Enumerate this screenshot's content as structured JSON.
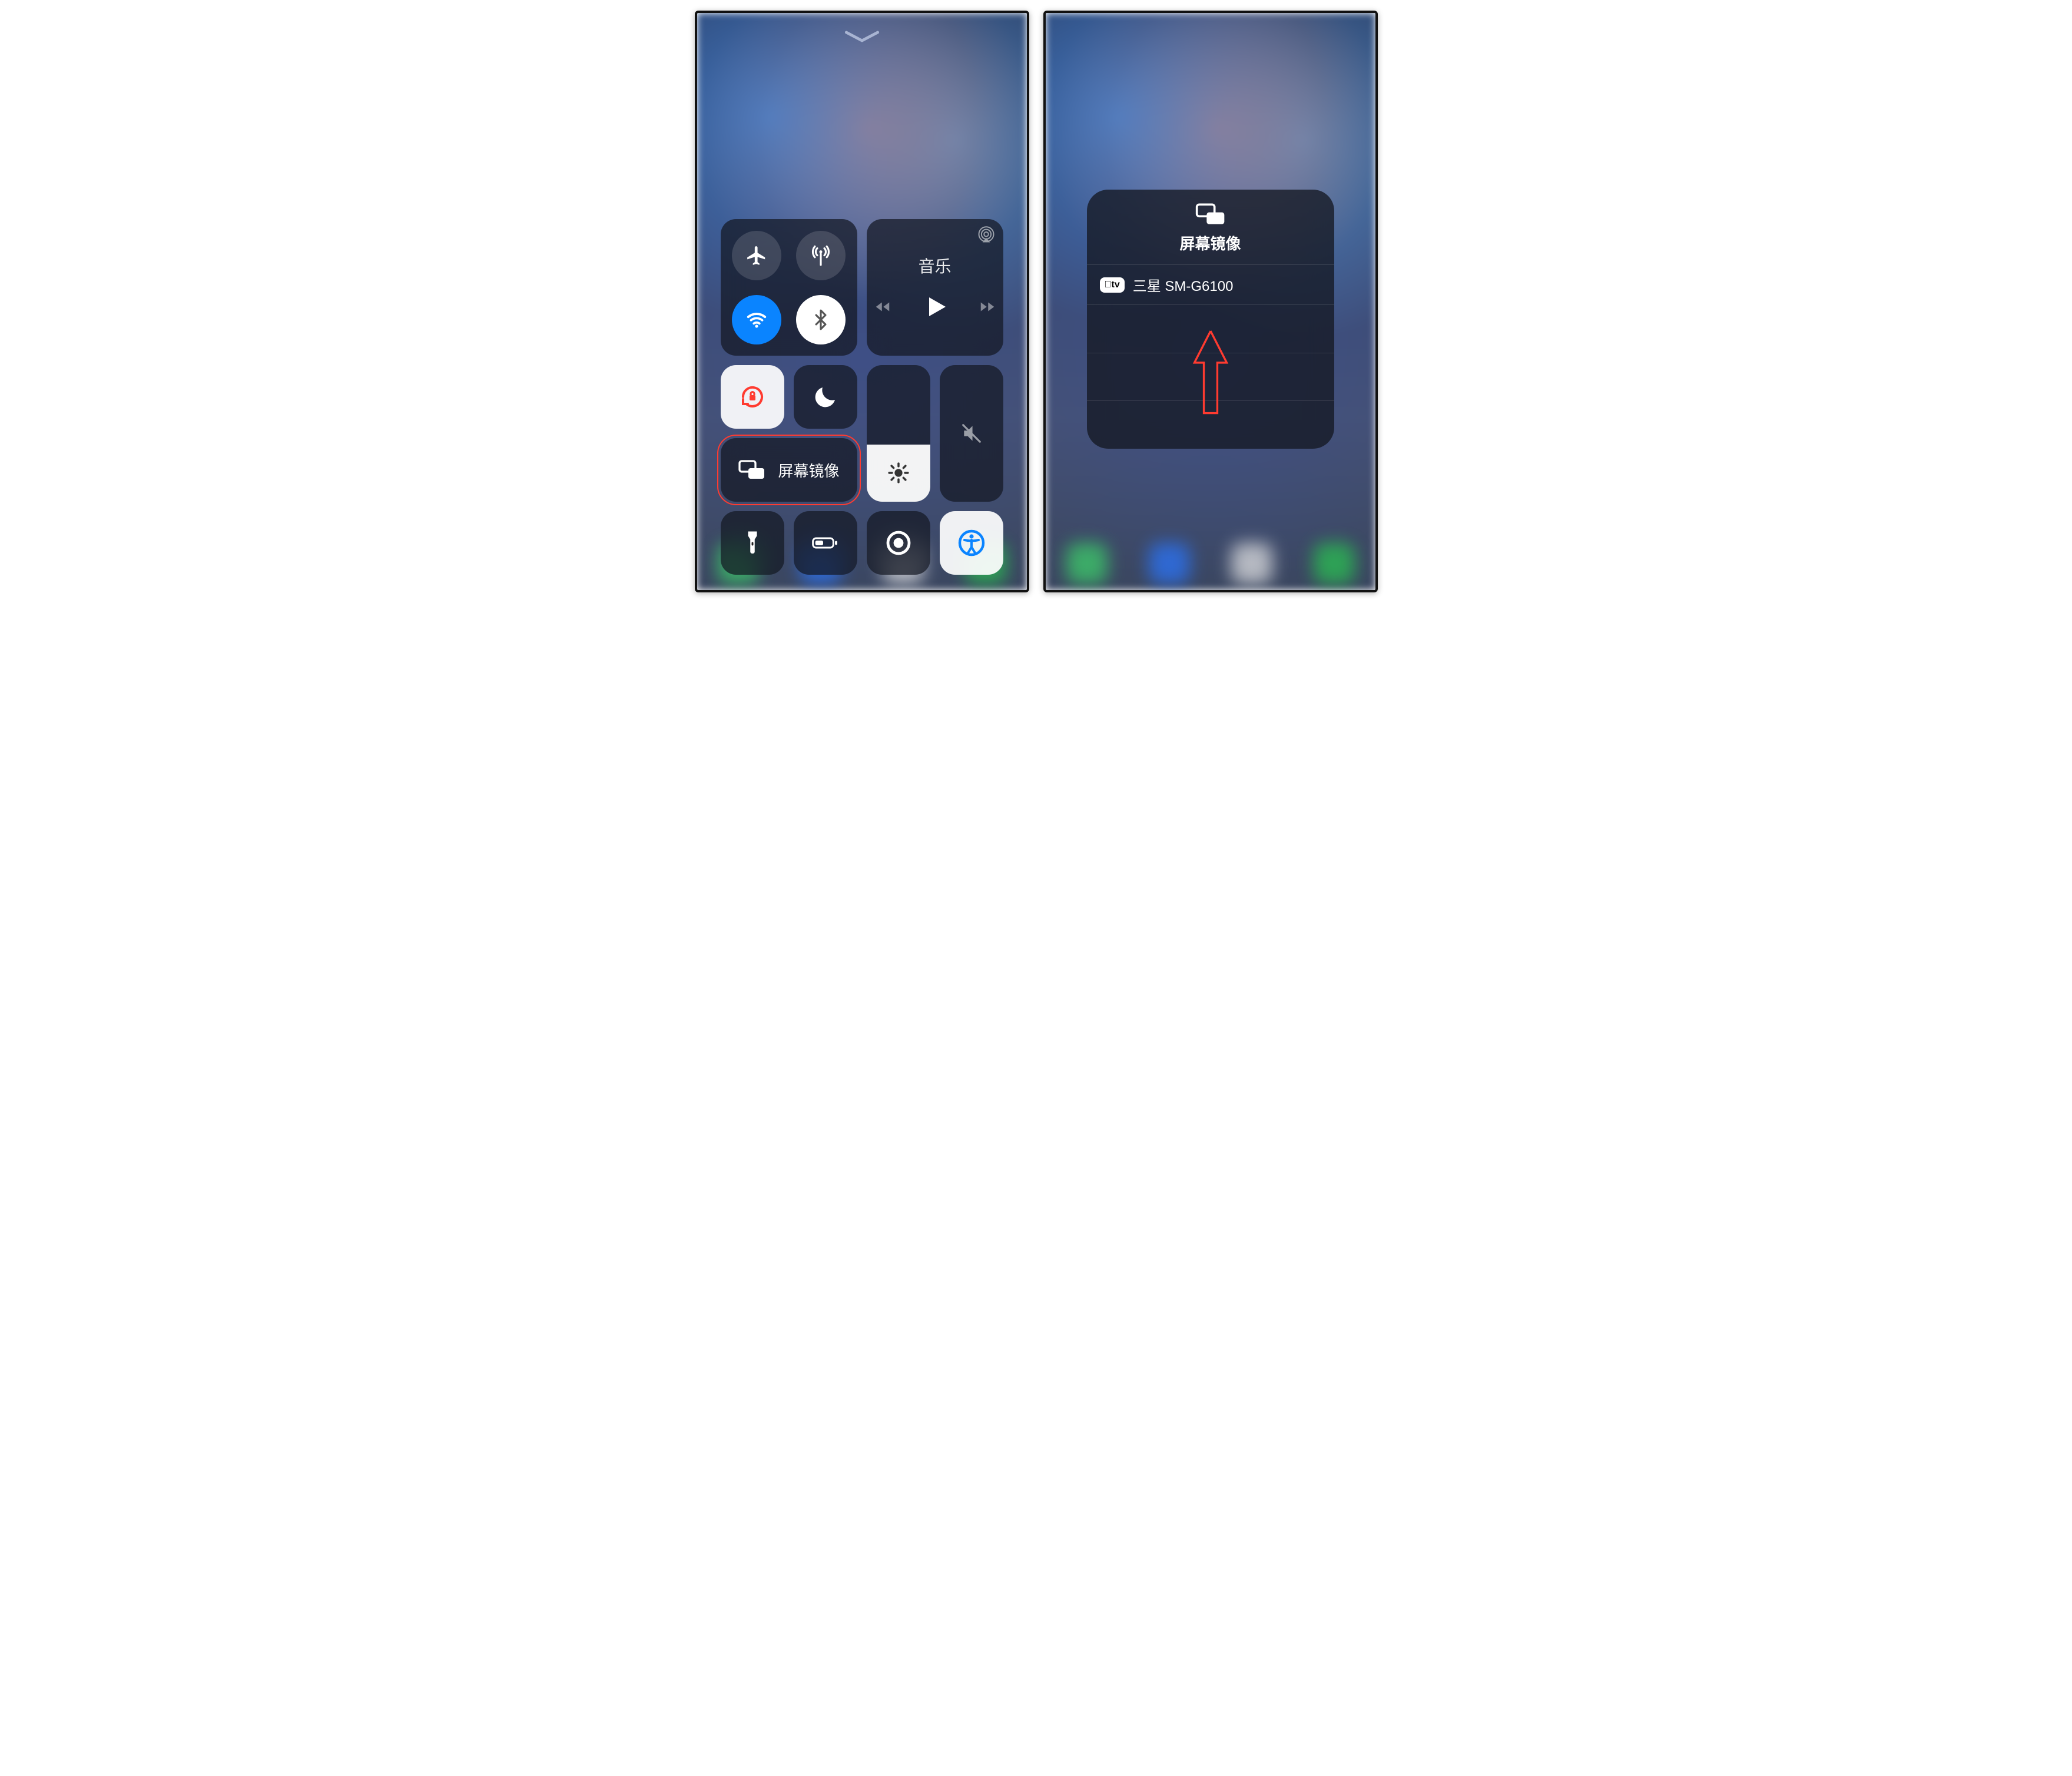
{
  "left": {
    "connectivity": {},
    "music": {
      "title": "音乐"
    },
    "screen_mirroring": {
      "label": "屏幕镜像"
    },
    "brightness_pct": 42,
    "volume_pct": 0
  },
  "right": {
    "popup_title": "屏幕镜像",
    "devices": [
      {
        "badge": "tv",
        "name": "三星 SM-G6100"
      }
    ]
  }
}
